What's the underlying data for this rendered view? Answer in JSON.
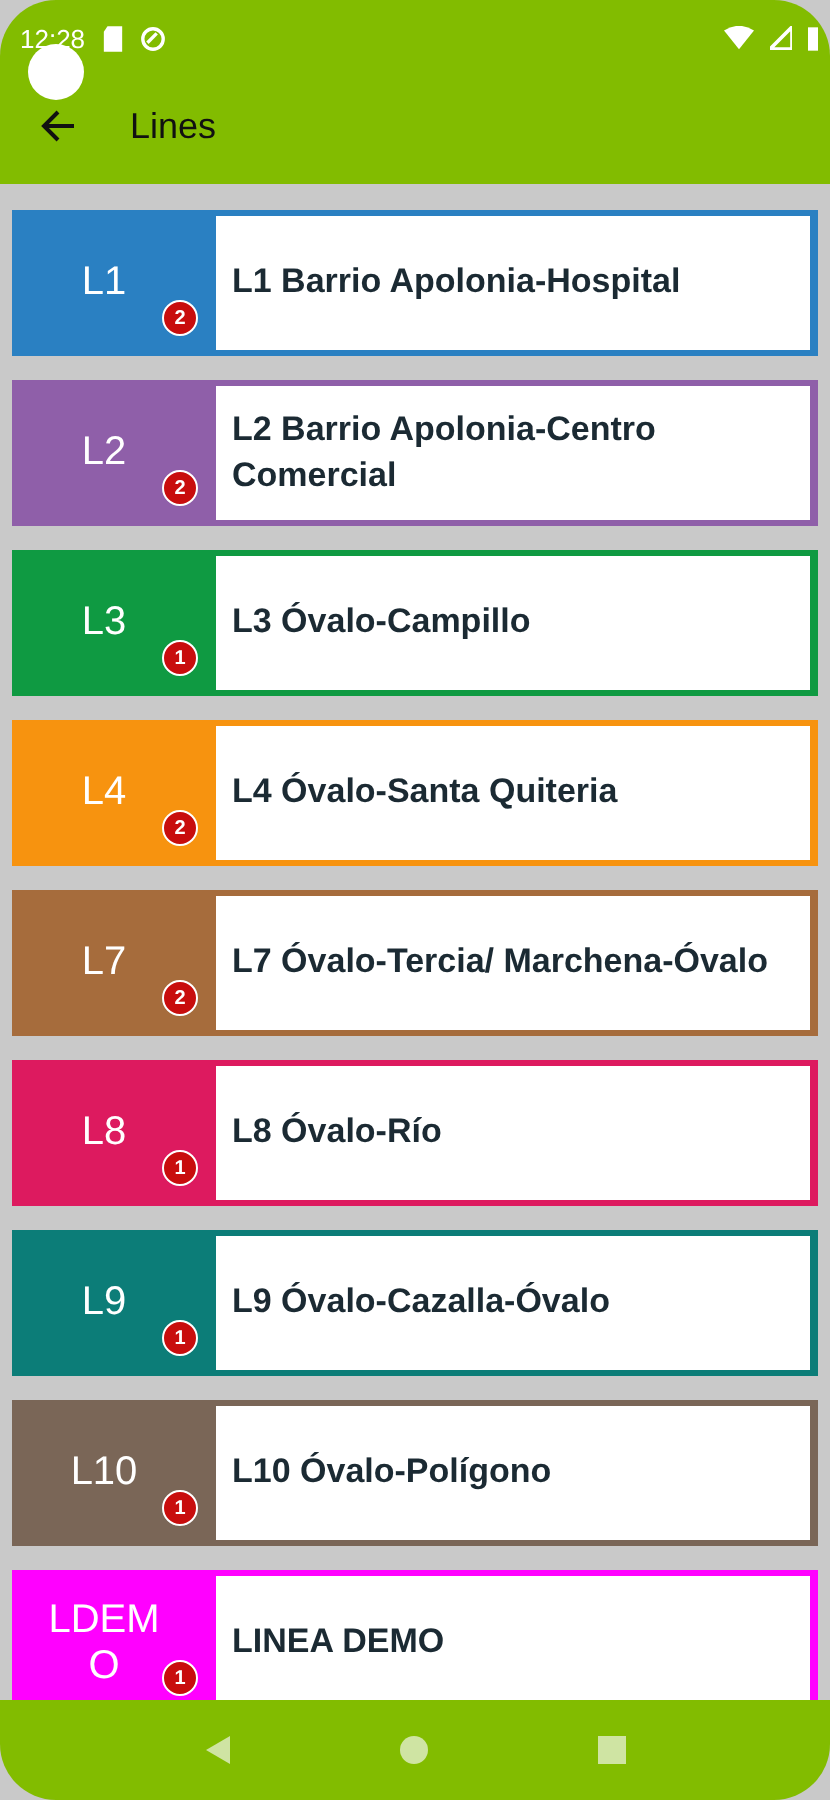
{
  "status_bar": {
    "time": "12:28"
  },
  "toolbar": {
    "title": "Lines"
  },
  "lines": [
    {
      "code": "L1",
      "name": "L1 Barrio Apolonia-Hospital",
      "badge": "2",
      "color": "#2a80c2"
    },
    {
      "code": "L2",
      "name": "L2 Barrio Apolonia-Centro Comercial",
      "badge": "2",
      "color": "#8f5fa9"
    },
    {
      "code": "L3",
      "name": "L3 Óvalo-Campillo",
      "badge": "1",
      "color": "#0f9a42"
    },
    {
      "code": "L4",
      "name": "L4 Óvalo-Santa Quiteria",
      "badge": "2",
      "color": "#f7930f"
    },
    {
      "code": "L7",
      "name": "L7 Óvalo-Tercia/ Marchena-Óvalo",
      "badge": "2",
      "color": "#a66c3c"
    },
    {
      "code": "L8",
      "name": "L8 Óvalo-Río",
      "badge": "1",
      "color": "#dd1a5f"
    },
    {
      "code": "L9",
      "name": "L9 Óvalo-Cazalla-Óvalo",
      "badge": "1",
      "color": "#0c7d78"
    },
    {
      "code": "L10",
      "name": "L10 Óvalo-Polígono",
      "badge": "1",
      "color": "#7a6657"
    },
    {
      "code": "LDEMO",
      "name": "LINEA DEMO",
      "badge": "1",
      "color": "#ff00ff"
    }
  ]
}
